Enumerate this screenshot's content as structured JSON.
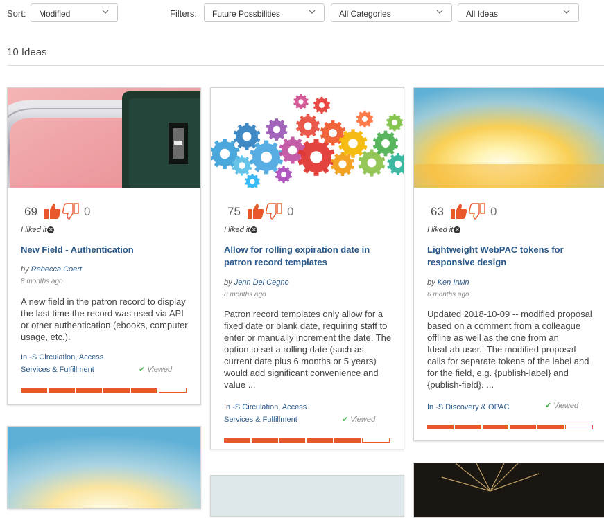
{
  "toolbar": {
    "sort_label": "Sort:",
    "sort_value": "Modified",
    "filters_label": "Filters:",
    "filter_1": "Future Possbilities",
    "filter_2": "All Categories",
    "filter_3": "All Ideas"
  },
  "ideas_count": "10 Ideas",
  "colors": {
    "accent": "#e8582a",
    "title": "#2b5a8a",
    "viewed_check": "#4caf50"
  },
  "cards": [
    {
      "image": "padlock-photo",
      "up_votes": "69",
      "down_votes": "0",
      "liked": "I liked it",
      "title": "New Field - Authentication",
      "by": "by",
      "author": "Rebecca Coert",
      "ago": "8 months ago",
      "description": "A new field in the patron record to display the last time the record was used via API or other authentication (ebooks, computer usage, etc.).",
      "category_prefix": "In",
      "category": "-S Circulation, Access Services & Fulfillment",
      "viewed": "Viewed",
      "progress_segments_filled": 5,
      "progress_segments_total": 6
    },
    {
      "image": "colorful-gears-illustration",
      "up_votes": "75",
      "down_votes": "0",
      "liked": "I liked it",
      "title": "Allow for rolling expiration date in patron record templates",
      "by": "by",
      "author": "Jenn Del Cegno",
      "ago": "8 months ago",
      "description": "Patron record templates only allow for a fixed date or blank date, requiring staff to enter or manually increment the date. The option to set a rolling date (such as current date plus 6 months or 5 years) would add significant convenience and value ...",
      "category_prefix": "In",
      "category": "-S Circulation, Access Services & Fulfillment",
      "viewed": "Viewed",
      "progress_segments_filled": 5,
      "progress_segments_total": 6
    },
    {
      "image": "sunburst-sky-photo",
      "up_votes": "63",
      "down_votes": "0",
      "liked": "I liked it",
      "title": "Lightweight WebPAC tokens for responsive design",
      "by": "by",
      "author": "Ken Irwin",
      "ago": "6 months ago",
      "description": "Updated 2018-10-09 -- modified proposal based on a comment from a colleague offline as well as the one from an IdeaLab user.. The modified proposal calls for separate tokens of the label and for the field, e.g. {publish-label} and {publish-field}. ...",
      "category_prefix": "In",
      "category": "-S Discovery & OPAC",
      "viewed": "Viewed",
      "progress_segments_filled": 5,
      "progress_segments_total": 6
    }
  ]
}
